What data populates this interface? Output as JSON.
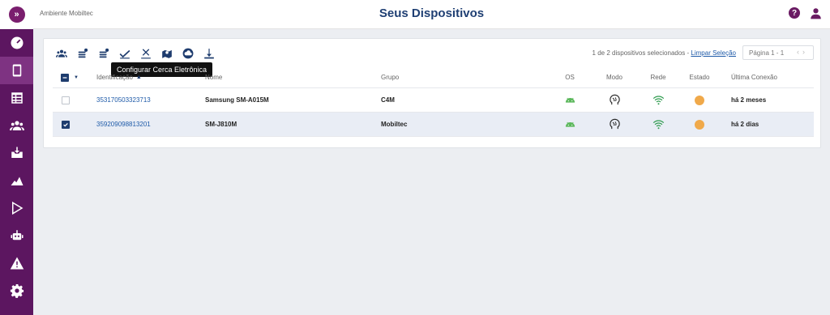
{
  "app": {
    "environment": "Ambiente Mobiltec",
    "title": "Seus Dispositivos",
    "logo_text": "»"
  },
  "header": {
    "help_label": "?"
  },
  "sidebar": {
    "items": [
      {
        "name": "dashboard",
        "icon": "gauge-icon"
      },
      {
        "name": "devices",
        "icon": "phone-icon",
        "active": true
      },
      {
        "name": "reports",
        "icon": "table-icon"
      },
      {
        "name": "groups",
        "icon": "users-icon"
      },
      {
        "name": "inbox",
        "icon": "inbox-download-icon"
      },
      {
        "name": "apps",
        "icon": "app-grid-icon"
      },
      {
        "name": "play",
        "icon": "play-icon"
      },
      {
        "name": "robot",
        "icon": "robot-icon"
      },
      {
        "name": "alerts",
        "icon": "warning-icon"
      },
      {
        "name": "settings",
        "icon": "gear-icon"
      }
    ]
  },
  "toolbar": {
    "tooltip": "Configurar Cerca Eletrônica",
    "tools": [
      "groups-icon",
      "stack-add-icon",
      "stack-settings-icon",
      "check-icon",
      "close-icon",
      "map-pin-icon",
      "cloud-icon",
      "download-icon"
    ]
  },
  "selection": {
    "info": "1 de 2 dispositivos selecionados - ",
    "clear_label": "Limpar Seleção",
    "page_label": "Página 1 - 1"
  },
  "table": {
    "columns": {
      "id": "Identificação",
      "name": "Nome",
      "group": "Grupo",
      "os": "OS",
      "mode": "Modo",
      "network": "Rede",
      "state": "Estado",
      "last": "Última Conexão"
    },
    "rows": [
      {
        "id": "353170503323713",
        "name": "Samsung SM-A015M",
        "group": "C4M",
        "last": "há 2 meses",
        "selected": false
      },
      {
        "id": "359209098813201",
        "name": "SM-J810M",
        "group": "Mobiltec",
        "last": "há 2 dias",
        "selected": true
      }
    ]
  },
  "colors": {
    "brand": "#5c1660",
    "accent": "#1e3c6e",
    "android": "#5cb85c",
    "wifi": "#2e9b4e",
    "state": "#f0a94a"
  }
}
